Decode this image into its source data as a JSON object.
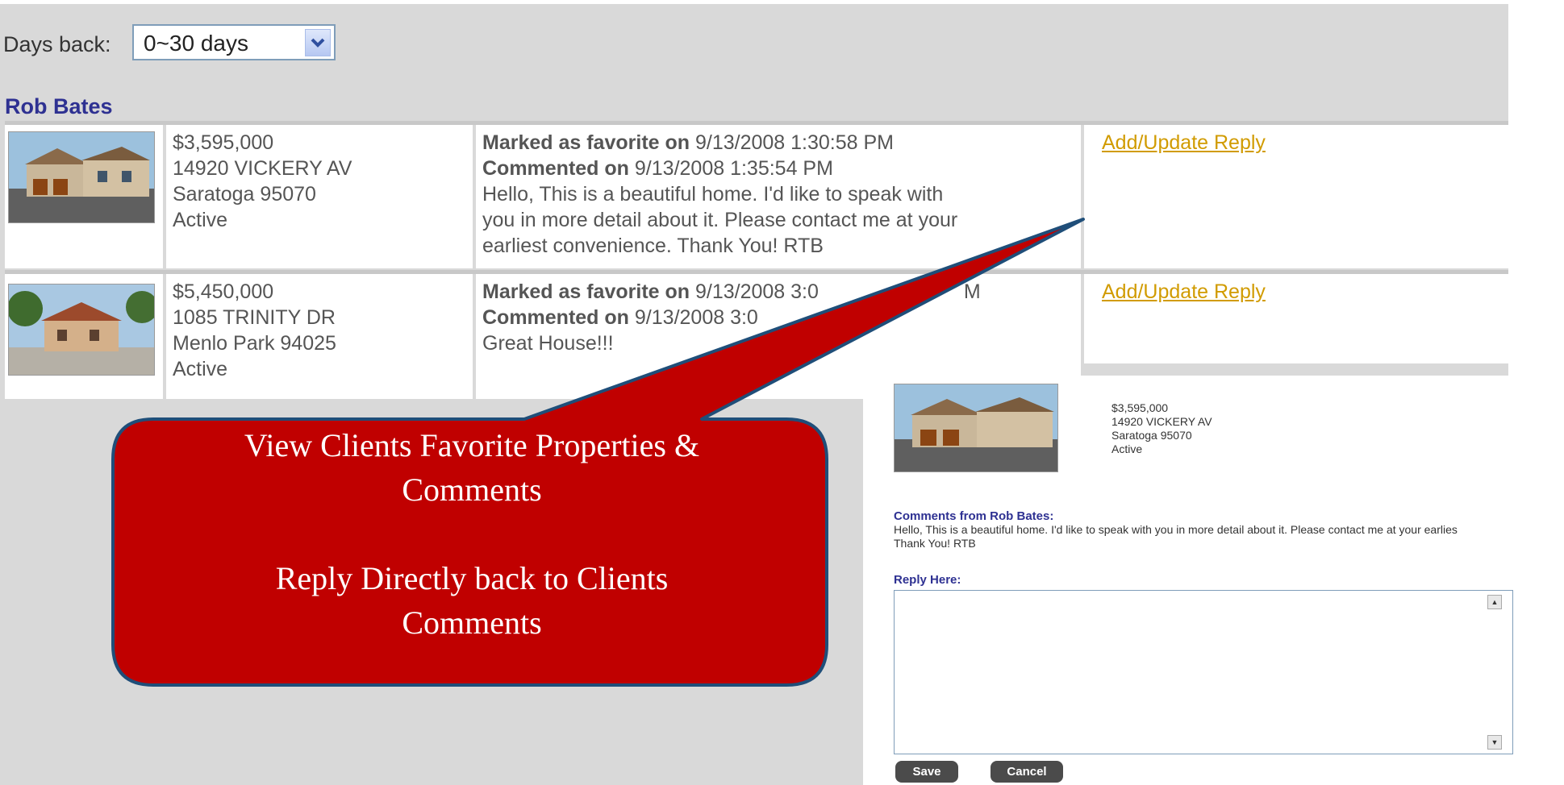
{
  "filter": {
    "label": "Days back:",
    "value": "0~30 days"
  },
  "client": {
    "name": "Rob Bates"
  },
  "listings": [
    {
      "price": "$3,595,000",
      "address": "14920 VICKERY AV",
      "city_zip": "Saratoga 95070",
      "status": "Active",
      "favorite_label": "Marked as favorite on",
      "favorite_date": "9/13/2008 1:30:58 PM",
      "commented_label": "Commented on",
      "commented_date": "9/13/2008 1:35:54 PM",
      "comment_lines": [
        "Hello, This is a beautiful home. I'd like to speak with",
        "you in more detail about it. Please contact me at your",
        "earliest convenience. Thank You! RTB"
      ],
      "reply_link": "Add/Update Reply"
    },
    {
      "price": "$5,450,000",
      "address": "1085 TRINITY DR",
      "city_zip": "Menlo Park 94025",
      "status": "Active",
      "favorite_label": "Marked as favorite on",
      "favorite_date": "9/13/2008 3:0",
      "favorite_tail": "M",
      "commented_label": "Commented on",
      "commented_date": "9/13/2008 3:0",
      "comment_lines": [
        "Great House!!!"
      ],
      "reply_link": "Add/Update Reply"
    }
  ],
  "reply_panel": {
    "price": "$3,595,000",
    "address": "14920 VICKERY AV",
    "city_zip": "Saratoga 95070",
    "status": "Active",
    "comments_heading": "Comments from Rob Bates:",
    "comment_line1": "Hello, This is a beautiful home. I'd like to speak with you in more detail about it. Please contact me at your earlies",
    "comment_line2": "Thank You! RTB",
    "reply_heading": "Reply Here:",
    "reply_value": "",
    "save_label": "Save",
    "cancel_label": "Cancel"
  },
  "callout": {
    "line1": "View Clients Favorite Properties &",
    "line2": "Comments",
    "line3": "Reply Directly back to Clients",
    "line4": "Comments",
    "fill_color": "#c00000",
    "border_color": "#1f4e79"
  }
}
